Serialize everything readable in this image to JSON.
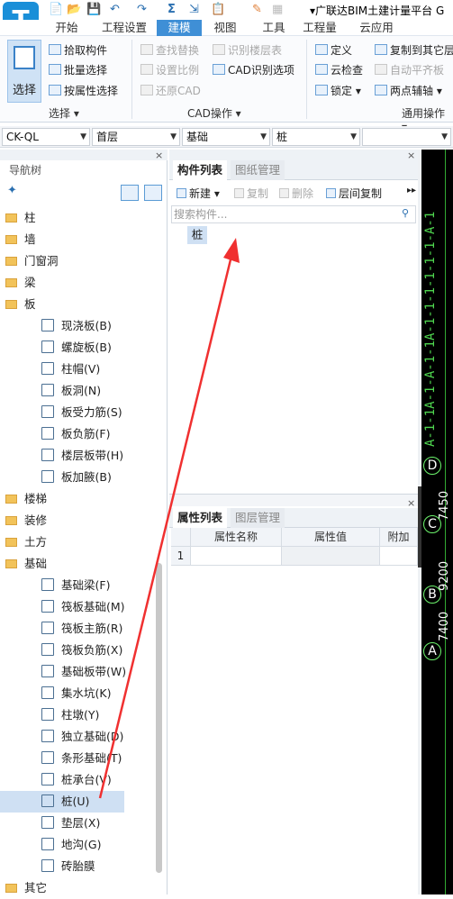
{
  "app": {
    "logo_letter": "T",
    "title": "▾广联达BIM土建计量平台 G"
  },
  "quick_access": [
    "📄",
    "📂",
    "💾",
    "↶",
    "↷",
    "Σ",
    "⇲",
    "📋",
    "✎",
    "▦"
  ],
  "menu": {
    "items": [
      {
        "label": "开始",
        "active": false
      },
      {
        "label": "工程设置",
        "active": false
      },
      {
        "label": "建模",
        "active": true
      },
      {
        "label": "视图",
        "active": false
      },
      {
        "label": "工具",
        "active": false
      },
      {
        "label": "工程量",
        "active": false
      },
      {
        "label": "云应用",
        "active": false
      }
    ]
  },
  "ribbon": {
    "select_group": {
      "big_button": "选择",
      "items": [
        "拾取构件",
        "批量选择",
        "按属性选择"
      ],
      "label": "选择 ▾"
    },
    "cad_group": {
      "items": [
        {
          "label": "查找替换",
          "disabled": true
        },
        {
          "label": "设置比例",
          "disabled": true
        },
        {
          "label": "还原CAD",
          "disabled": true
        },
        {
          "label": "识别楼层表",
          "disabled": true
        },
        {
          "label": "CAD识别选项",
          "disabled": false
        }
      ],
      "label": "CAD操作 ▾"
    },
    "general_group": {
      "items": [
        {
          "label": "定义",
          "disabled": false
        },
        {
          "label": "云检查",
          "disabled": false
        },
        {
          "label": "锁定 ▾",
          "disabled": false
        },
        {
          "label": "复制到其它层",
          "disabled": false
        },
        {
          "label": "自动平齐板",
          "disabled": true
        },
        {
          "label": "两点辅轴 ▾",
          "disabled": false
        }
      ],
      "label": "通用操作 ▾"
    }
  },
  "combos": [
    "CK-QL",
    "首层",
    "基础",
    "桩",
    ""
  ],
  "nav": {
    "title": "导航树",
    "tree": [
      {
        "label": "柱",
        "level": 0,
        "type": "folder"
      },
      {
        "label": "墙",
        "level": 0,
        "type": "folder"
      },
      {
        "label": "门窗洞",
        "level": 0,
        "type": "folder"
      },
      {
        "label": "梁",
        "level": 0,
        "type": "folder"
      },
      {
        "label": "板",
        "level": 0,
        "type": "folder"
      },
      {
        "label": "现浇板(B)",
        "level": 1,
        "type": "item"
      },
      {
        "label": "螺旋板(B)",
        "level": 1,
        "type": "item"
      },
      {
        "label": "柱帽(V)",
        "level": 1,
        "type": "item"
      },
      {
        "label": "板洞(N)",
        "level": 1,
        "type": "item"
      },
      {
        "label": "板受力筋(S)",
        "level": 1,
        "type": "item"
      },
      {
        "label": "板负筋(F)",
        "level": 1,
        "type": "item"
      },
      {
        "label": "楼层板带(H)",
        "level": 1,
        "type": "item"
      },
      {
        "label": "板加腋(B)",
        "level": 1,
        "type": "item"
      },
      {
        "label": "楼梯",
        "level": 0,
        "type": "folder"
      },
      {
        "label": "装修",
        "level": 0,
        "type": "folder"
      },
      {
        "label": "土方",
        "level": 0,
        "type": "folder"
      },
      {
        "label": "基础",
        "level": 0,
        "type": "folder"
      },
      {
        "label": "基础梁(F)",
        "level": 1,
        "type": "item"
      },
      {
        "label": "筏板基础(M)",
        "level": 1,
        "type": "item"
      },
      {
        "label": "筏板主筋(R)",
        "level": 1,
        "type": "item"
      },
      {
        "label": "筏板负筋(X)",
        "level": 1,
        "type": "item"
      },
      {
        "label": "基础板带(W)",
        "level": 1,
        "type": "item"
      },
      {
        "label": "集水坑(K)",
        "level": 1,
        "type": "item"
      },
      {
        "label": "柱墩(Y)",
        "level": 1,
        "type": "item"
      },
      {
        "label": "独立基础(D)",
        "level": 1,
        "type": "item"
      },
      {
        "label": "条形基础(T)",
        "level": 1,
        "type": "item"
      },
      {
        "label": "桩承台(V)",
        "level": 1,
        "type": "item"
      },
      {
        "label": "桩(U)",
        "level": 1,
        "type": "item",
        "selected": true
      },
      {
        "label": "垫层(X)",
        "level": 1,
        "type": "item"
      },
      {
        "label": "地沟(G)",
        "level": 1,
        "type": "item"
      },
      {
        "label": "砖胎膜",
        "level": 1,
        "type": "item"
      },
      {
        "label": "其它",
        "level": 0,
        "type": "folder"
      }
    ]
  },
  "component_panel": {
    "tabs": [
      "构件列表",
      "图纸管理"
    ],
    "toolbar": [
      {
        "label": "新建 ▾",
        "disabled": false
      },
      {
        "label": "复制",
        "disabled": true
      },
      {
        "label": "删除",
        "disabled": true
      },
      {
        "label": "层间复制",
        "disabled": false
      }
    ],
    "search_placeholder": "搜索构件...",
    "items": [
      "桩"
    ]
  },
  "property_panel": {
    "tabs": [
      "属性列表",
      "图层管理"
    ],
    "columns": [
      "属性名称",
      "属性值",
      "附加"
    ],
    "rows": [
      [
        "1",
        "",
        ""
      ]
    ]
  },
  "cad_view": {
    "axis_labels": [
      "D",
      "C",
      "B",
      "A"
    ],
    "dimensions": [
      "7450",
      "9200",
      "7400"
    ],
    "top_labels": "A-1-1A-1-A-1-1A-1-1-1-1-1-1-A-1"
  },
  "colors": {
    "accent": "#3f8fd6",
    "selected": "#cfe0f3",
    "arrow": "#f03030",
    "cad_bg": "#000000"
  }
}
